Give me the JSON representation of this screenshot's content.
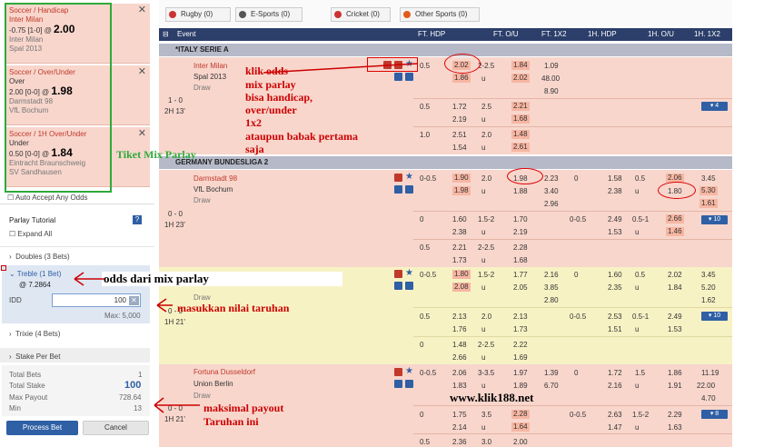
{
  "bets": [
    {
      "type": "Soccer / Handicap",
      "pick": "Inter Milan",
      "line": "-0.75 [1-0]",
      "odds": "2.00",
      "match": "Inter Milan",
      "opp": "Spal 2013"
    },
    {
      "type": "Soccer / Over/Under",
      "pick": "Over",
      "line": "2.00 [0-0]",
      "odds": "1.98",
      "match": "Darmstadt 98",
      "opp": "VfL Bochum"
    },
    {
      "type": "Soccer / 1H Over/Under",
      "pick": "Under",
      "line": "0.50 [0-0]",
      "odds": "1.84",
      "match": "Eintracht Braunschweig",
      "opp": "SV Sandhausen"
    }
  ],
  "left": {
    "auto_accept": "Auto Accept Any Odds",
    "parlay_tutorial": "Parlay Tutorial",
    "help": "?",
    "expand_all": "Expand All",
    "doubles": "Doubles (3 Bets)",
    "treble": "Treble (1 Bet)",
    "treble_odds": "@ 7.2864",
    "idd": "IDD",
    "stake_value": "100",
    "max": "Max: 5,000",
    "trixie": "Trixie (4 Bets)",
    "stake_per_bet": "Stake Per Bet",
    "total_bets_label": "Total Bets",
    "total_bets": "1",
    "total_stake_label": "Total Stake",
    "total_stake": "100",
    "max_payout_label": "Max Payout",
    "max_payout": "728.64",
    "min_label": "Min",
    "min": "13",
    "process_bet": "Process Bet",
    "cancel": "Cancel"
  },
  "sports": [
    "Rugby (0)",
    "E-Sports (0)",
    "Cricket (0)",
    "Other Sports (0)"
  ],
  "header": {
    "event": "Event",
    "ft_hdp": "FT. HDP",
    "ft_ou": "FT. O/U",
    "ft_1x2": "FT. 1X2",
    "h1_hdp": "1H. HDP",
    "h1_ou": "1H. O/U",
    "h1_1x2": "1H. 1X2"
  },
  "leagues": {
    "l1": "*ITALY SERIE A",
    "l2": "GERMANY BUNDESLIGA 2"
  },
  "matches": {
    "m1": {
      "home": "Inter Milan",
      "away": "Spal 2013",
      "draw": "Draw",
      "score": "1 - 0",
      "time": "2H 13'",
      "more": "▾ 4"
    },
    "m2": {
      "home": "Darmstadt 98",
      "away": "VfL Bochum",
      "draw": "Draw",
      "score": "0 - 0",
      "time": "1H 23'",
      "more": "▾ 10"
    },
    "m3": {
      "draw": "Draw",
      "score": "0 - 0",
      "time": "1H 21'",
      "more": "▾ 10"
    },
    "m4": {
      "home": "Fortuna Dusseldorf",
      "away": "Union Berlin",
      "draw": "Draw",
      "score": "0 - 0",
      "time": "1H 21'",
      "more": "▾ 8"
    }
  },
  "annotations": {
    "a1": "klik odds",
    "a2": "mix parlay",
    "a3": "bisa handicap,",
    "a4": "over/under",
    "a5": "1x2",
    "a6": "ataupun babak pertama",
    "a7": "saja",
    "tiket": "Tiket Mix Parlay",
    "odds_mix": "odds dari mix parlay",
    "masukkan": "masukkan nilai taruhan",
    "maks1": "maksimal payout",
    "maks2": "Taruhan ini",
    "site": "www.klik188.net"
  },
  "colors": {
    "header": "#2c3e6a",
    "pink": "#f8d6cc",
    "yellow": "#f7f2c4",
    "accent": "#c00000",
    "green": "#2eaa3a"
  }
}
